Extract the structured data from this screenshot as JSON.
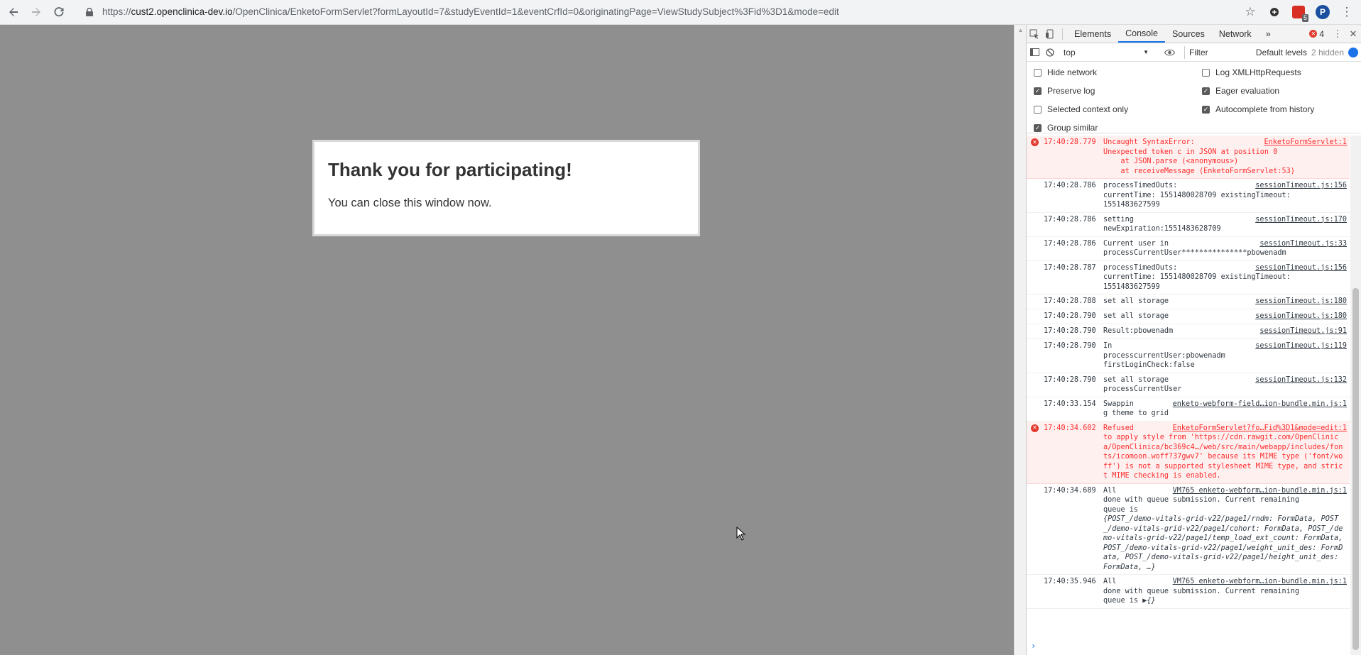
{
  "browser": {
    "url_prefix": "https://",
    "url_host": "cust2.openclinica-dev.io",
    "url_path": "/OpenClinica/EnketoFormServlet?formLayoutId=7&studyEventId=1&eventCrfId=0&originatingPage=ViewStudySubject%3Fid%3D1&mode=edit",
    "extension_badge": "5",
    "profile_initial": "P"
  },
  "page": {
    "heading": "Thank you for participating!",
    "message": "You can close this window now."
  },
  "devtools": {
    "tabs": [
      "Elements",
      "Console",
      "Sources",
      "Network"
    ],
    "active_tab": "Console",
    "more_tabs": "»",
    "error_count": "4",
    "context": "top",
    "filter_placeholder": "Filter",
    "levels": "Default levels",
    "hidden": "2 hidden",
    "options": [
      {
        "label": "Hide network",
        "checked": false
      },
      {
        "label": "Log XMLHttpRequests",
        "checked": false
      },
      {
        "label": "Preserve log",
        "checked": true
      },
      {
        "label": "Eager evaluation",
        "checked": true
      },
      {
        "label": "Selected context only",
        "checked": false
      },
      {
        "label": "Autocomplete from history",
        "checked": true
      },
      {
        "label": "Group similar",
        "checked": true
      }
    ],
    "messages": [
      {
        "level": "error",
        "time": "17:40:28.779",
        "source": "EnketoFormServlet:1",
        "text": "Uncaught SyntaxError:\nUnexpected token c in JSON at position 0\n    at JSON.parse (<anonymous>)\n    at receiveMessage (EnketoFormServlet:53)"
      },
      {
        "level": "info",
        "time": "17:40:28.786",
        "source": "sessionTimeout.js:156",
        "text": "processTimedOuts:\ncurrentTime: 1551480028709 existingTimeout:\n1551483627599"
      },
      {
        "level": "info",
        "time": "17:40:28.786",
        "source": "sessionTimeout.js:170",
        "text": "setting\nnewExpiration:1551483628709"
      },
      {
        "level": "info",
        "time": "17:40:28.786",
        "source": "sessionTimeout.js:33",
        "text": "Current user in\nprocessCurrentUser***************pbowenadm"
      },
      {
        "level": "info",
        "time": "17:40:28.787",
        "source": "sessionTimeout.js:156",
        "text": "processTimedOuts:\ncurrentTime: 1551480028709 existingTimeout:\n1551483627599"
      },
      {
        "level": "info",
        "time": "17:40:28.788",
        "source": "sessionTimeout.js:180",
        "text": "set all storage"
      },
      {
        "level": "info",
        "time": "17:40:28.790",
        "source": "sessionTimeout.js:180",
        "text": "set all storage"
      },
      {
        "level": "info",
        "time": "17:40:28.790",
        "source": "sessionTimeout.js:91",
        "text": "Result:pbowenadm"
      },
      {
        "level": "info",
        "time": "17:40:28.790",
        "source": "sessionTimeout.js:119",
        "text": "In\nprocesscurrentUser:pbowenadm\nfirstLoginCheck:false"
      },
      {
        "level": "info",
        "time": "17:40:28.790",
        "source": "sessionTimeout.js:132",
        "text": "set all storage\nprocessCurrentUser"
      },
      {
        "level": "info",
        "time": "17:40:33.154",
        "source": "enketo-webform-field…ion-bundle.min.js:1",
        "text": "Swappin\ng theme to grid"
      },
      {
        "level": "error",
        "time": "17:40:34.602",
        "source": "EnketoFormServlet?fo…Fid%3D1&mode=edit:1",
        "text": "Refused\nto apply style from 'https://cdn.rawgit.com/OpenClinica/OpenClinica/bc369c4…/web/src/main/webapp/includes/fonts/icomoon.woff?37gwv7' because its MIME type ('font/woff') is not a supported stylesheet MIME type, and strict MIME checking is enabled."
      },
      {
        "level": "info",
        "time": "17:40:34.689",
        "source": "VM765 enketo-webform…ion-bundle.min.js:1",
        "text": "All\ndone with queue submission. Current remaining\nqueue is",
        "object": "{POST_/demo-vitals-grid-v22/page1/rndm: FormData, POST_/demo-vitals-grid-v22/page1/cohort: FormData, POST_/demo-vitals-grid-v22/page1/temp_load_ext_count: FormData, POST_/demo-vitals-grid-v22/page1/weight_unit_des: FormData, POST_/demo-vitals-grid-v22/page1/height_unit_des: FormData, …}"
      },
      {
        "level": "info",
        "time": "17:40:35.946",
        "source": "VM765 enketo-webform…ion-bundle.min.js:1",
        "text": "All\ndone with queue submission. Current remaining\nqueue is",
        "object": "▶{}"
      }
    ],
    "prompt": "›"
  }
}
